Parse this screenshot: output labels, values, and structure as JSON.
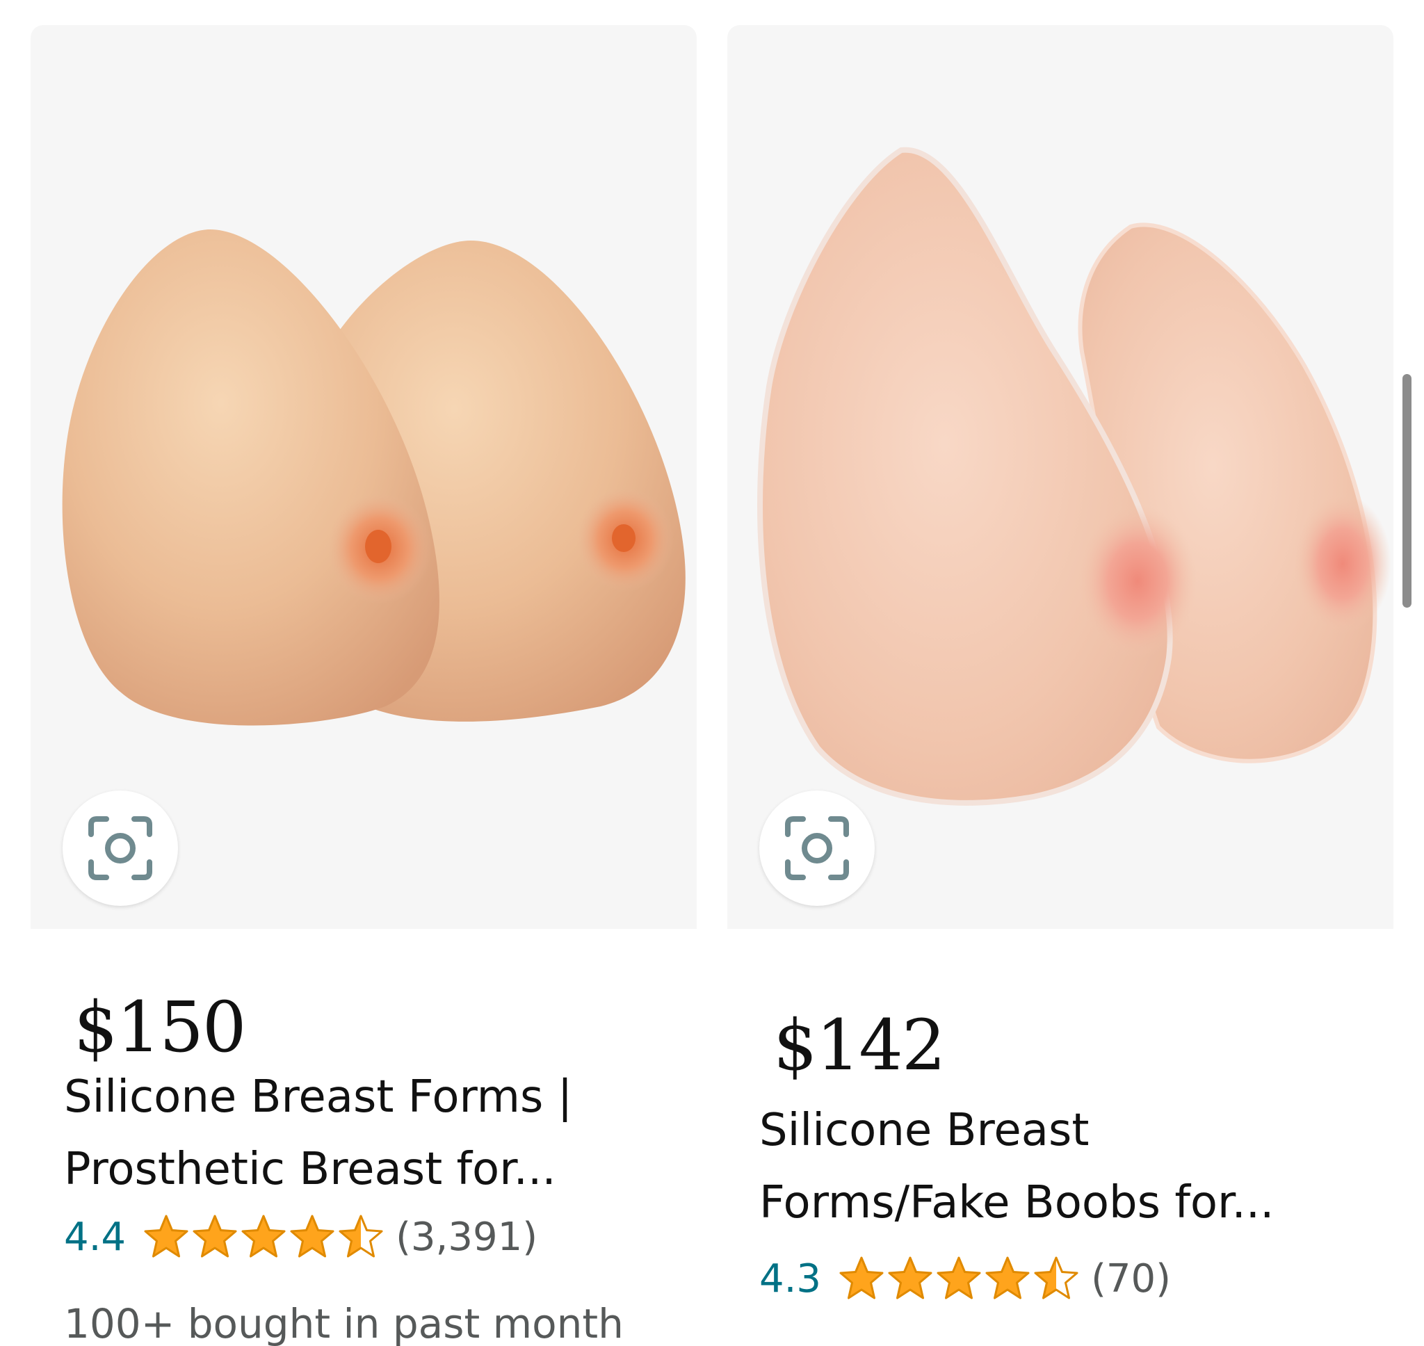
{
  "colors": {
    "card_image_bg": "#f6f6f6",
    "rating_teal": "#007185",
    "star_orange": "#ffa41c",
    "secondary_text": "#565959",
    "primary_text": "#111111"
  },
  "products": [
    {
      "price": "$150",
      "title_line1": "Silicone Breast Forms |",
      "title_line2": "Prosthetic Breast for...",
      "rating": "4.4",
      "star_fill": 4.5,
      "review_count": "(3,391)",
      "bought_text": "100+ bought in past month",
      "lens_icon": "camera-lens-icon",
      "image": "Product photo: pair of teardrop-shaped silicone breast forms"
    },
    {
      "price": "$142",
      "title_line1": "Silicone Breast",
      "title_line2": "Forms/Fake Boobs for...",
      "rating": "4.3",
      "star_fill": 4.5,
      "review_count": "(70)",
      "lens_icon": "camera-lens-icon",
      "image": "Product photo: pair of translucent silicone breast forms"
    }
  ]
}
